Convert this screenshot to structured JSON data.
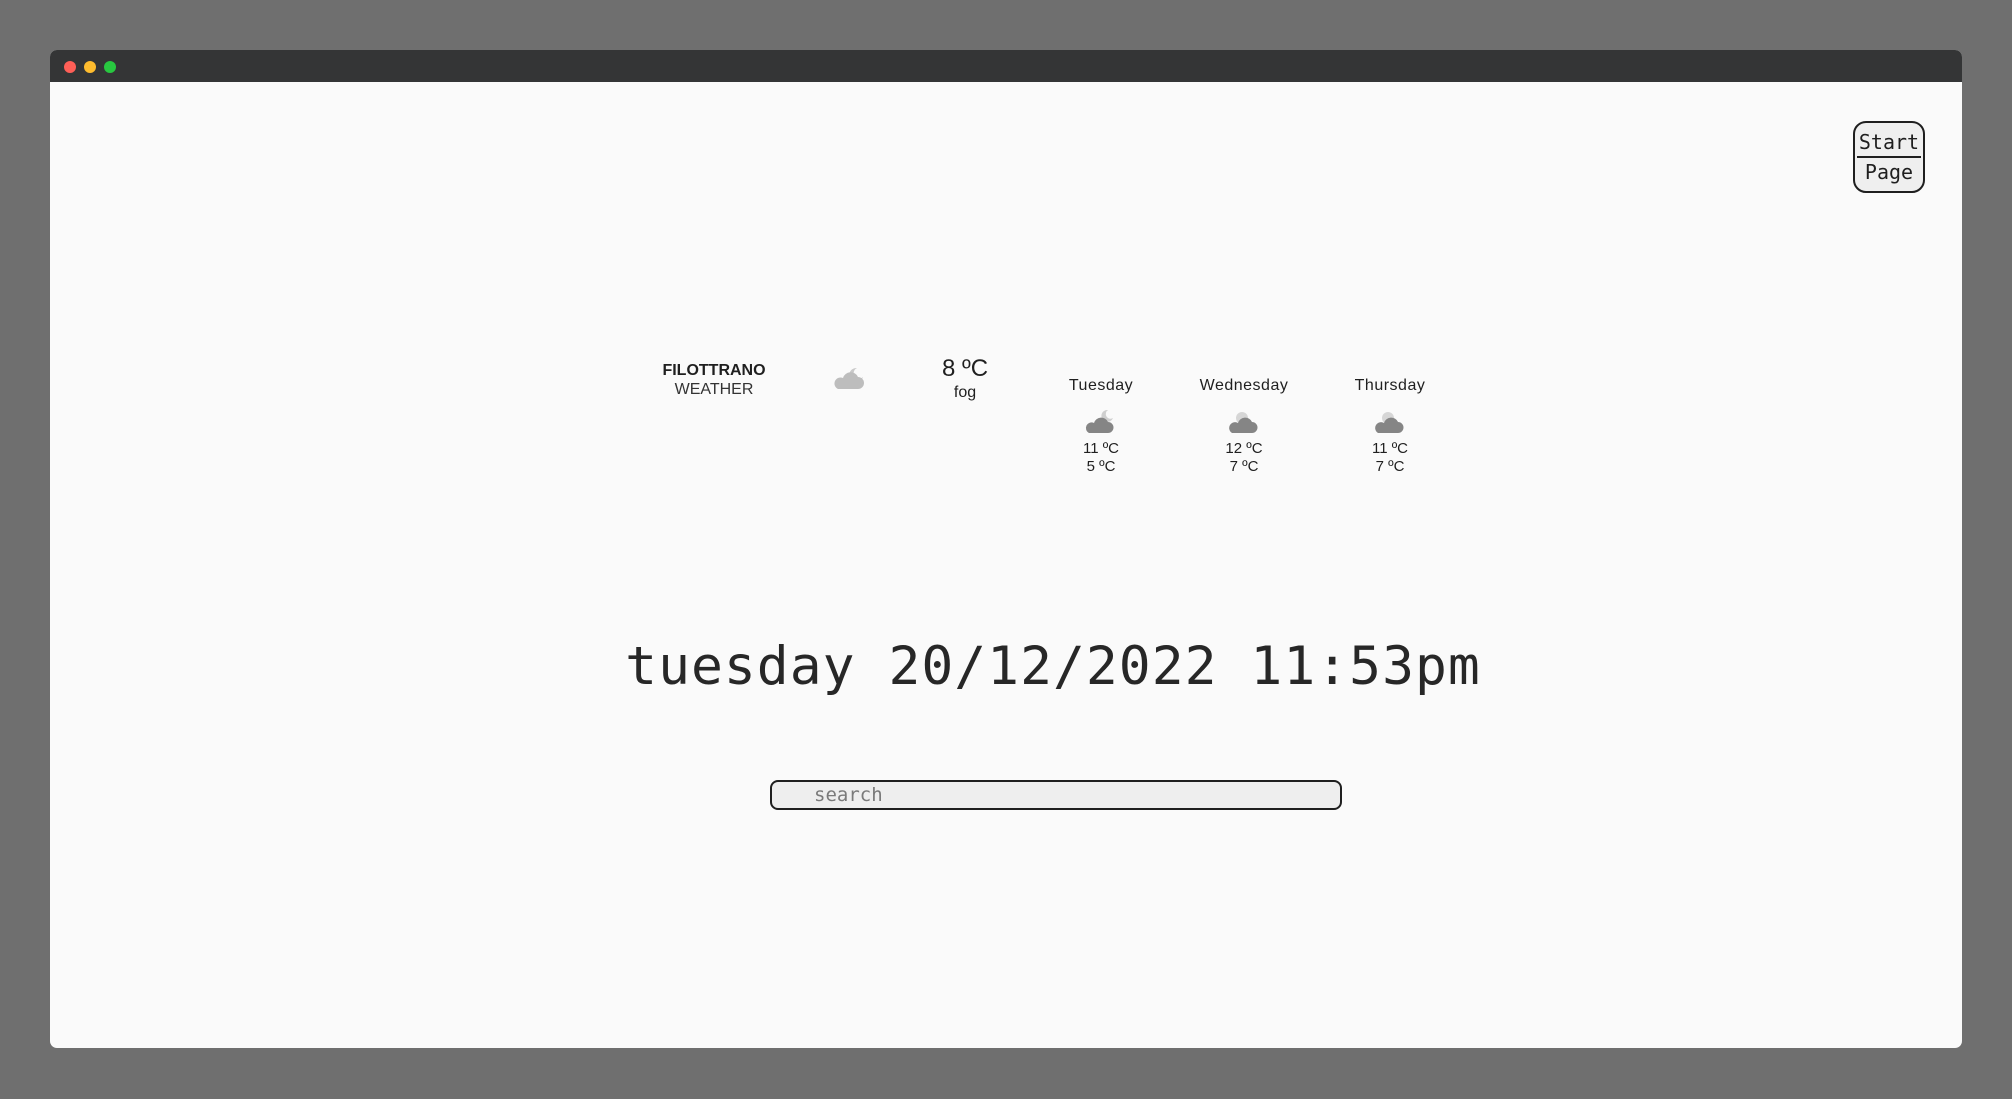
{
  "window": {
    "traffic_colors": {
      "close": "#ff5f57",
      "minimize": "#febc2e",
      "maximize": "#28c840"
    }
  },
  "start_page": {
    "line1": "Start",
    "line2": "Page"
  },
  "weather": {
    "city": "FILOTTRANO",
    "label": "WEATHER",
    "current_icon": "cloud-moon-icon",
    "current_temp": "8 ºC",
    "current_desc": "fog",
    "forecast": [
      {
        "day": "Tuesday",
        "icon": "cloud-moon-icon",
        "high": "11 ºC",
        "low": "5 ºC"
      },
      {
        "day": "Wednesday",
        "icon": "cloud-sun-icon",
        "high": "12 ºC",
        "low": "7 ºC"
      },
      {
        "day": "Thursday",
        "icon": "cloud-sun-icon",
        "high": "11 ºC",
        "low": "7 ºC"
      }
    ]
  },
  "clock": {
    "text": "tuesday 20/12/2022 11:53pm"
  },
  "search": {
    "placeholder": "search",
    "value": ""
  }
}
